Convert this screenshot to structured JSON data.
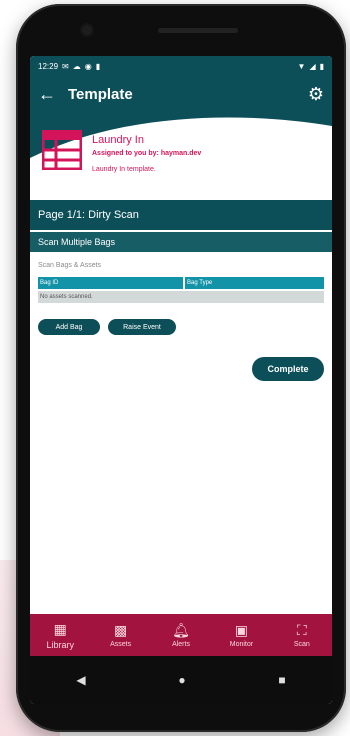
{
  "status_bar": {
    "time": "12:29",
    "icons_left": [
      "mail-icon",
      "cloud-icon",
      "circle-play-icon",
      "clipboard-icon"
    ],
    "icons_right": [
      "wifi-icon",
      "signal-icon",
      "battery-icon"
    ]
  },
  "app_bar": {
    "title": "Template"
  },
  "header": {
    "title": "Laundry In",
    "assigned": "Assigned to you by: hayman.dev",
    "description": "Laundry In template."
  },
  "page_title": "Page 1/1: Dirty Scan",
  "section_title": "Scan Multiple Bags",
  "scan_label": "Scan Bags & Assets",
  "table": {
    "columns": [
      "Bag ID",
      "Bag Type"
    ],
    "empty_text": "No assets scanned."
  },
  "buttons": {
    "add_bag": "Add Bag",
    "raise_event": "Raise Event",
    "complete": "Complete"
  },
  "bottom_nav": [
    {
      "label": "Library",
      "icon": "library-icon"
    },
    {
      "label": "Assets",
      "icon": "grid-icon"
    },
    {
      "label": "Alerts",
      "icon": "bell-icon"
    },
    {
      "label": "Monitor",
      "icon": "monitor-icon"
    },
    {
      "label": "Scan",
      "icon": "scan-icon"
    }
  ],
  "colors": {
    "primary": "#0d4f59",
    "accent": "#d4145a",
    "table_header": "#1293a7",
    "bottom_nav": "#a3133f"
  }
}
